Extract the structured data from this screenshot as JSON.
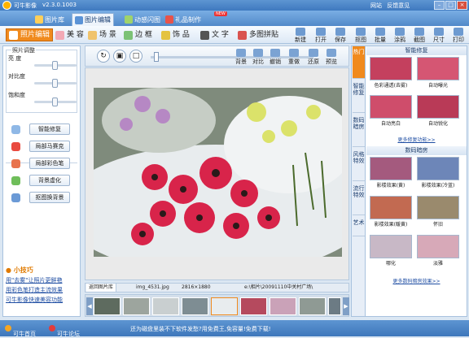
{
  "app": {
    "name": "可牛影像",
    "version": "v2.3.0.1003",
    "links": [
      "网站",
      "反馈意见"
    ]
  },
  "window_controls": [
    "minimize",
    "maximize",
    "close"
  ],
  "top_tabs": [
    {
      "label": "图片库",
      "icon": "picture-library-icon",
      "active": false
    },
    {
      "label": "图片编辑",
      "icon": "edit-icon",
      "active": true
    },
    {
      "label": "动感闪图",
      "icon": "flash-icon",
      "active": false
    },
    {
      "label": "礼品制作",
      "icon": "gift-icon",
      "active": false,
      "badge": "NEW"
    }
  ],
  "tools": [
    {
      "label": "照片编辑",
      "icon": "photo-edit-icon",
      "active": true
    },
    {
      "label": "美 容",
      "icon": "beauty-icon",
      "active": false
    },
    {
      "label": "场 景",
      "icon": "scene-icon",
      "active": false
    },
    {
      "label": "边 框",
      "icon": "border-icon",
      "active": false
    },
    {
      "label": "饰 品",
      "icon": "decoration-icon",
      "active": false
    },
    {
      "label": "文 字",
      "icon": "text-icon",
      "active": false
    },
    {
      "label": "多图拼贴",
      "icon": "collage-icon",
      "active": false
    }
  ],
  "file_actions": [
    "新建",
    "打开",
    "保存",
    "抠图",
    "批量",
    "涂鸦",
    "截图",
    "尺寸",
    "打印"
  ],
  "adjust": {
    "group_title": "照片调整",
    "brightness_label": "亮 度",
    "contrast_label": "对比度",
    "saturation_label": "饱和度",
    "brightness": 0.5,
    "contrast": 0.5,
    "saturation": 0.5
  },
  "functions": [
    {
      "label": "智能修复",
      "icon": "magic-wand-icon"
    },
    {
      "label": "局部马赛克",
      "icon": "mosaic-icon"
    },
    {
      "label": "局部彩色笔",
      "icon": "color-pen-icon"
    },
    {
      "label": "背景虚化",
      "icon": "blur-icon"
    },
    {
      "label": "抠图换背景",
      "icon": "cutout-icon"
    }
  ],
  "tips": {
    "title": "小技巧",
    "links": [
      "用\"去雾\"让照片更鲜艳",
      "用彩色笔打造主流效果",
      "可牛影像快速美容功能"
    ]
  },
  "canvas_tools": [
    "背景",
    "对比",
    "撤销",
    "重做",
    "还原",
    "预览"
  ],
  "image_info": {
    "back_label": "返回图片库",
    "filename": "img_4531.jpg",
    "size": "2816×1880",
    "path": "e:\\相片\\20091110中关村广场\\"
  },
  "right_panel": {
    "vertical_tabs": [
      "热门",
      "智能修复",
      "数码暗房",
      "风格特效",
      "流行特效",
      "艺术"
    ],
    "sections": [
      {
        "title": "智能修复",
        "effects": [
          "色彩通透(去雾)",
          "自动曝光",
          "自动亮白",
          "自动锐化"
        ],
        "more": "更多修复功能>>"
      },
      {
        "title": "数码暗房",
        "effects": [
          "影楼效果(黄)",
          "影楼效果(冷蓝)",
          "影楼效果(暖黄)",
          "怀旧",
          "哪化",
          "淡雅"
        ],
        "more": "更多数码暗房效果>>"
      }
    ]
  },
  "status": {
    "home_link": "可牛首页",
    "forum_link": "可牛论坛",
    "promo": "还为磁盘里装不下软件发愁?用免费王,免容量!免费下载!"
  },
  "colors": {
    "accent": "#f08a1d",
    "titlebar": "#4a84c8",
    "link": "#1f4ea3"
  }
}
